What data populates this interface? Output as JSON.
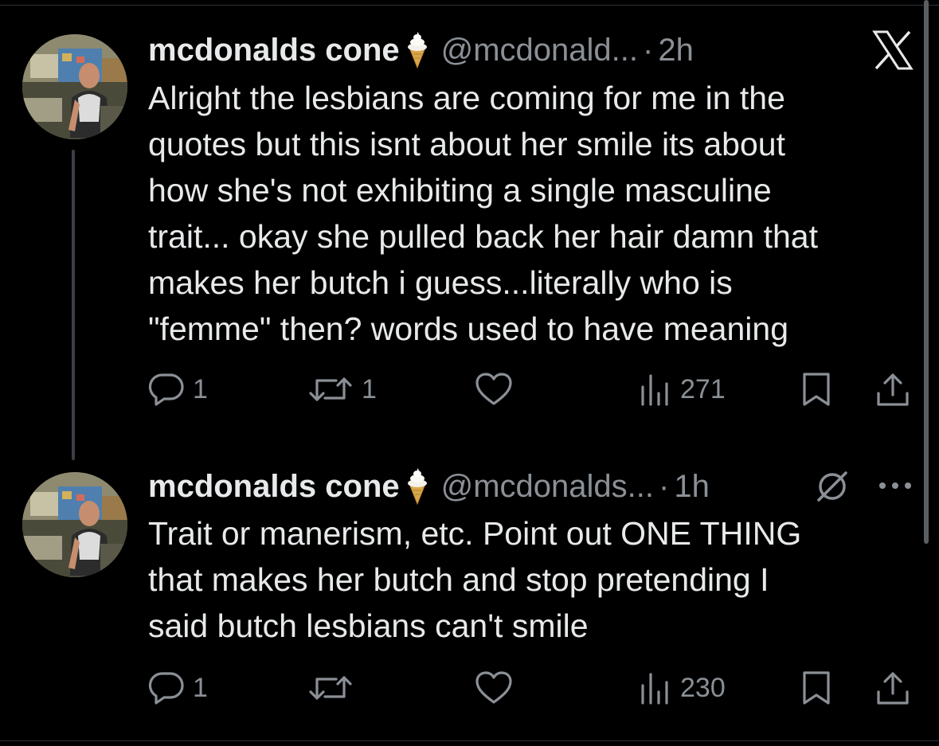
{
  "tweets": [
    {
      "name": "mcdonalds cone",
      "handle": "@mcdonald...",
      "separator": "·",
      "time": "2h",
      "text": "Alright the lesbians are coming for me in the\nquotes but this isnt about her smile its about\nhow she's not exhibiting a single masculine\ntrait... okay she pulled back her hair damn that\nmakes her butch i guess...literally who is\n\"femme\" then? words used to have meaning",
      "reply_count": "1",
      "repost_count": "1",
      "view_count": "271",
      "icons": [
        "ice-cream-cone-emoji",
        "x-logo",
        "reply-icon",
        "repost-icon",
        "like-icon",
        "views-icon",
        "bookmark-icon",
        "share-icon"
      ]
    },
    {
      "name": "mcdonalds cone",
      "handle": "@mcdonalds...",
      "separator": "·",
      "time": "1h",
      "text": "Trait or manerism, etc. Point out ONE THING\nthat makes her butch and stop pretending I\nsaid butch lesbians can't smile",
      "reply_count": "1",
      "repost_count": "",
      "view_count": "230",
      "icons": [
        "ice-cream-cone-emoji",
        "no-symbol-icon",
        "more-icon",
        "reply-icon",
        "repost-icon",
        "like-icon",
        "views-icon",
        "bookmark-icon",
        "share-icon"
      ]
    }
  ],
  "colors": {
    "background": "#000000",
    "primary_text": "#e7e9ea",
    "secondary_text": "#8b9096",
    "thread_line": "#3b3f43"
  }
}
